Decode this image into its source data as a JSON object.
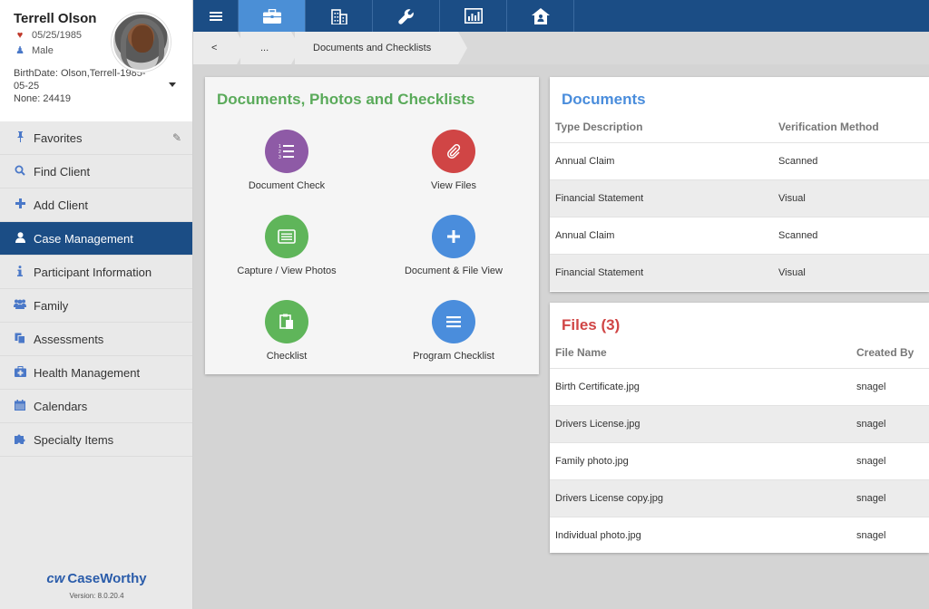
{
  "profile": {
    "name": "Terrell Olson",
    "dob": "05/25/1985",
    "gender": "Male",
    "birthdate_line": "BirthDate: Olson,Terrell-1985-05-25",
    "none_line": "None: 24419"
  },
  "sidebar": {
    "items": [
      {
        "label": "Favorites",
        "icon": "pin-icon"
      },
      {
        "label": "Find Client",
        "icon": "search-icon"
      },
      {
        "label": "Add Client",
        "icon": "plus-icon"
      },
      {
        "label": "Case Management",
        "icon": "user-icon"
      },
      {
        "label": "Participant Information",
        "icon": "info-icon"
      },
      {
        "label": "Family",
        "icon": "users-icon"
      },
      {
        "label": "Assessments",
        "icon": "copy-icon"
      },
      {
        "label": "Health Management",
        "icon": "medkit-icon"
      },
      {
        "label": "Calendars",
        "icon": "calendar-icon"
      },
      {
        "label": "Specialty Items",
        "icon": "puzzle-icon"
      }
    ],
    "active_index": 3
  },
  "brand": {
    "logo_mark": "cw",
    "logo_text": "CaseWorthy",
    "version": "Version: 8.0.20.4"
  },
  "topbar": {
    "apps": [
      "briefcase-icon",
      "building-icon",
      "wrench-icon",
      "chart-icon",
      "house-icon"
    ],
    "selected": "briefcase-icon"
  },
  "breadcrumb": {
    "back": "<",
    "ellipsis": "...",
    "current": "Documents and Checklists"
  },
  "docs_panel": {
    "title": "Documents, Photos and Checklists",
    "tiles": [
      {
        "label": "Document Check",
        "color": "#8e5aa6",
        "icon": "list-icon"
      },
      {
        "label": "View Files",
        "color": "#d04545",
        "icon": "paperclip-icon"
      },
      {
        "label": "Capture / View Photos",
        "color": "#5fb55a",
        "icon": "photo-icon"
      },
      {
        "label": "Document & File View",
        "color": "#4a8ddc",
        "icon": "plus-icon"
      },
      {
        "label": "Checklist",
        "color": "#5fb55a",
        "icon": "clipboard-icon"
      },
      {
        "label": "Program Checklist",
        "color": "#4a8ddc",
        "icon": "lines-icon"
      }
    ]
  },
  "documents": {
    "title": "Documents",
    "title_color": "#4a8ddc",
    "columns": [
      "Type Description",
      "Verification Method"
    ],
    "rows": [
      [
        "Annual Claim",
        "Scanned"
      ],
      [
        "Financial Statement",
        "Visual"
      ],
      [
        "Annual Claim",
        "Scanned"
      ],
      [
        "Financial Statement",
        "Visual"
      ]
    ]
  },
  "files": {
    "title": "Files (3)",
    "title_color": "#d04545",
    "columns": [
      "File Name",
      "Created By"
    ],
    "rows": [
      [
        "Birth Certificate.jpg",
        "snagel"
      ],
      [
        "Drivers License.jpg",
        "snagel"
      ],
      [
        "Family photo.jpg",
        "snagel"
      ],
      [
        "Drivers License copy.jpg",
        "snagel"
      ],
      [
        "Individual photo.jpg",
        "snagel"
      ]
    ]
  }
}
